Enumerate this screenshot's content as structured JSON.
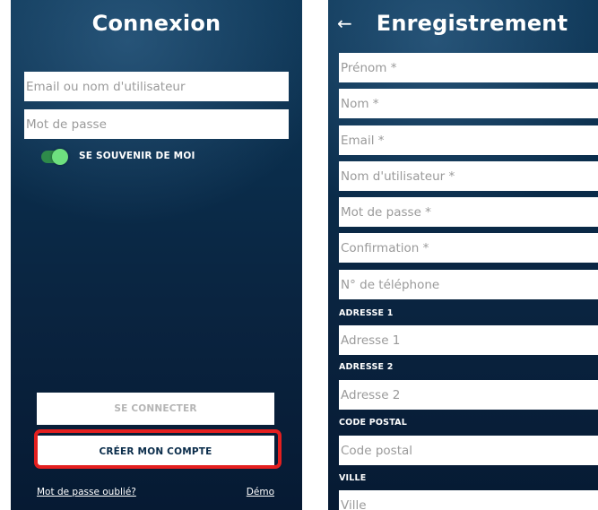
{
  "login": {
    "title": "Connexion",
    "email_placeholder": "Email ou nom d'utilisateur",
    "password_placeholder": "Mot de passe",
    "remember_label": "SE SOUVENIR DE MOI",
    "remember_on": true,
    "connect_label": "SE CONNECTER",
    "create_label": "CRÉER MON COMPTE",
    "forgot_label": "Mot de passe oublié?",
    "demo_label": "Démo",
    "highlight_color": "#e41f1f"
  },
  "register": {
    "back_icon": "←",
    "title": "Enregistrement",
    "fields": {
      "firstname": "Prénom *",
      "lastname": "Nom *",
      "email": "Email *",
      "username": "Nom d'utilisateur *",
      "password": "Mot de passe *",
      "confirmation": "Confirmation *",
      "phone": "N° de téléphone"
    },
    "address1_label": "ADRESSE 1",
    "address1_placeholder": "Adresse 1",
    "address2_label": "ADRESSE 2",
    "address2_placeholder": "Adresse 2",
    "postal_label": "CODE POSTAL",
    "postal_placeholder": "Code postal",
    "city_label": "VILLE",
    "city_placeholder": "Ville"
  },
  "colors": {
    "background_top": "#0d3656",
    "background_bottom": "#061a33",
    "toggle_knob": "#6ee07f"
  }
}
